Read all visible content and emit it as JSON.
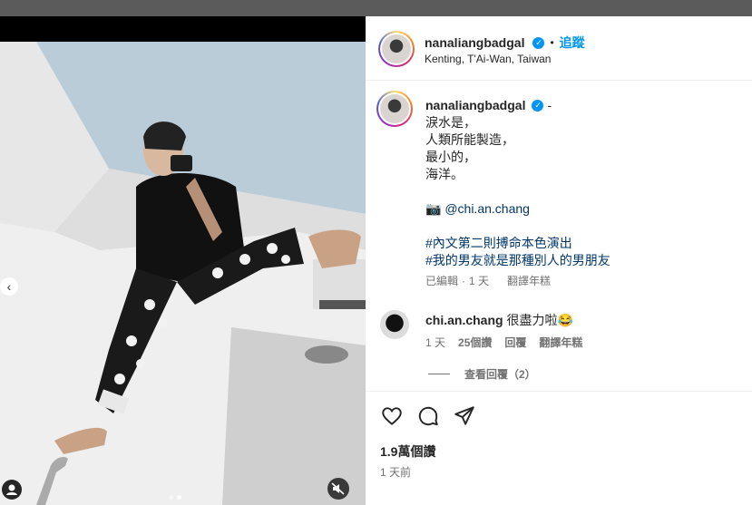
{
  "post": {
    "username": "nanaliangbadgal",
    "verified_mark": "✓",
    "dot": "•",
    "follow_label": "追蹤",
    "location": "Kenting, T'Ai-Wan, Taiwan"
  },
  "caption": {
    "username": "nanaliangbadgal",
    "suffix": "-",
    "lines": [
      "淚水是，",
      "人類所能製造，",
      "最小的，",
      "海洋。"
    ],
    "camera_emoji": "📷",
    "credit": "@chi.an.chang",
    "hashtags": [
      "#內文第二則搏命本色演出",
      "#我的男友就是那種別人的男朋友"
    ],
    "edited": "已編輯",
    "time": "1 天",
    "translate": "翻譯年糕"
  },
  "comment": {
    "username": "chi.an.chang",
    "text": "很盡力啦😂",
    "time": "1 天",
    "likes": "25個讚",
    "reply": "回覆",
    "translate": "翻譯年糕"
  },
  "view_replies": "查看回覆（2）",
  "actions": {
    "likes": "1.9萬個讚",
    "time": "1 天前"
  },
  "media": {
    "prev_icon": "‹",
    "carousel_active_index": 2,
    "carousel_count": 2
  },
  "colors": {
    "accent": "#0095f6",
    "text": "#262626",
    "secondary": "#737373"
  }
}
